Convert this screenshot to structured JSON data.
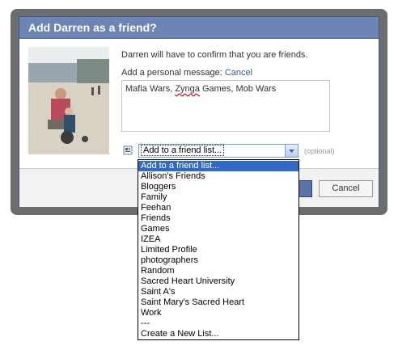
{
  "dialog": {
    "title": "Add Darren as a friend?",
    "confirm_text": "Darren will have to confirm that you are friends.",
    "message_label": "Add a personal message:",
    "cancel_link": "Cancel",
    "message_value_before": "Mafia Wars, ",
    "message_value_misspelled": "Zynga",
    "message_value_after": " Games, Mob Wars",
    "select_value": "Add to a friend list...",
    "optional_label": "(optional)",
    "cancel_button": "Cancel"
  },
  "dropdown": {
    "selected_index": 0,
    "options": [
      "Add to a friend list...",
      "Allison's Friends",
      "Bloggers",
      "Family",
      "Feehan",
      "Friends",
      "Games",
      "IZEA",
      "Limited Profile",
      "photographers",
      "Random",
      "Sacred Heart University",
      "Saint A's",
      "Saint Mary's Sacred Heart",
      "Work",
      "---",
      "Create a New List..."
    ]
  },
  "colors": {
    "header_bg": "#6d84b4",
    "accent": "#3b5998",
    "frame": "#6d6d6d",
    "selection": "#316ac5"
  }
}
